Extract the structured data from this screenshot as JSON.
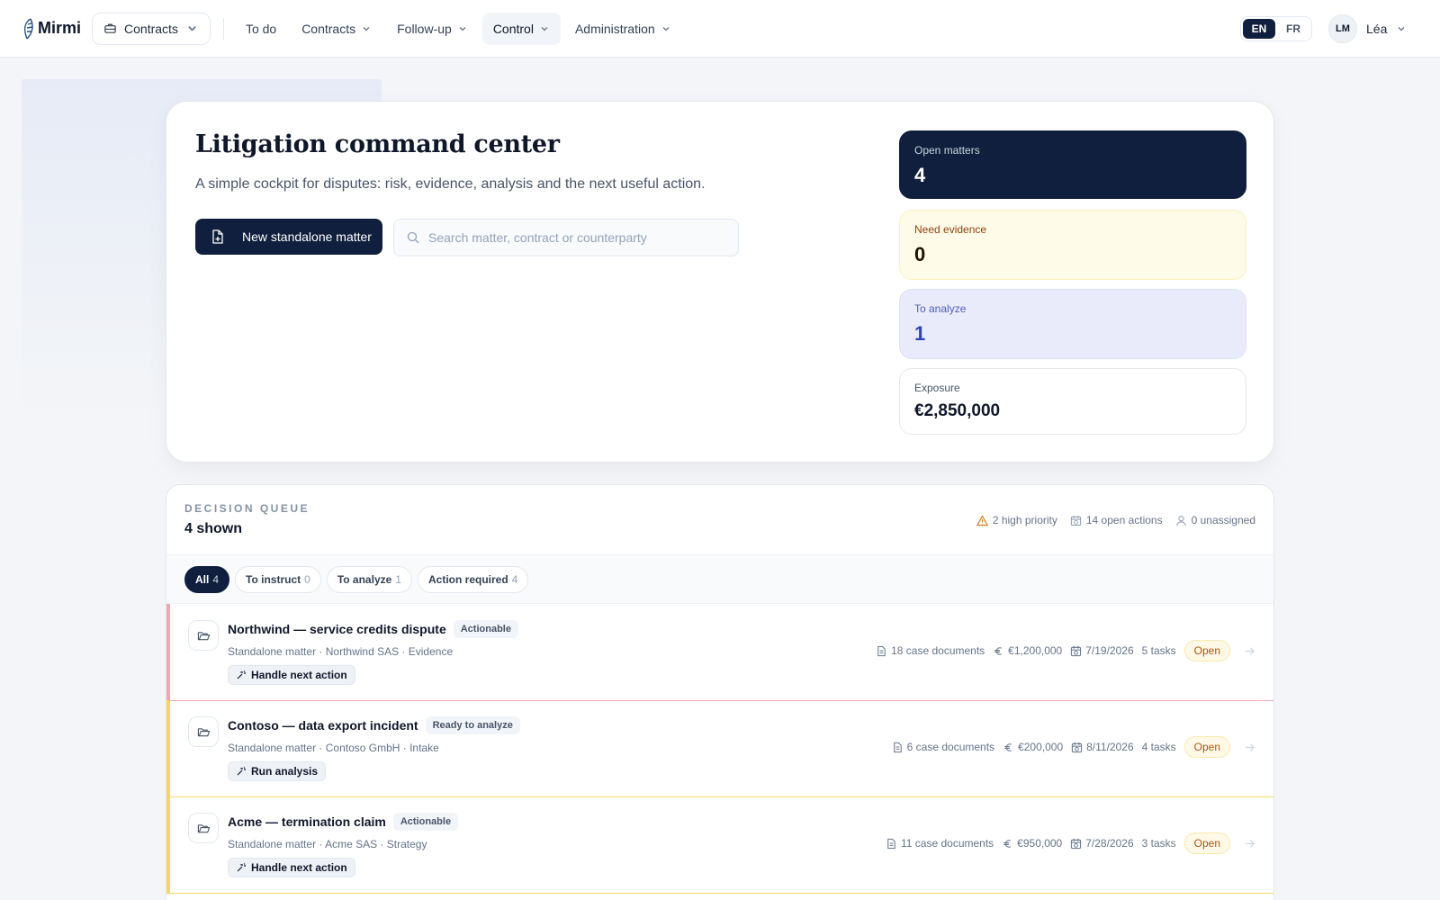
{
  "brand": {
    "name": "Mirmi"
  },
  "workspace": {
    "label": "Contracts"
  },
  "nav": {
    "todo": "To do",
    "contracts": "Contracts",
    "followup": "Follow-up",
    "control": "Control",
    "administration": "Administration"
  },
  "lang": {
    "en": "EN",
    "fr": "FR",
    "active": "EN"
  },
  "user": {
    "initials": "LM",
    "name": "Léa"
  },
  "hero": {
    "title": "Litigation command center",
    "subtitle": "A simple cockpit for disputes: risk, evidence, analysis and the next useful action.",
    "new_button": "New standalone matter",
    "search_placeholder": "Search matter, contract or counterparty"
  },
  "stats": {
    "open": {
      "label": "Open matters",
      "value": "4"
    },
    "evidence": {
      "label": "Need evidence",
      "value": "0"
    },
    "analyze": {
      "label": "To analyze",
      "value": "1"
    },
    "exposure": {
      "label": "Exposure",
      "value": "€2,850,000"
    }
  },
  "queue": {
    "kicker": "DECISION QUEUE",
    "count": "4 shown",
    "high_priority": "2 high priority",
    "open_actions": "14 open actions",
    "unassigned": "0 unassigned",
    "tabs": [
      {
        "label": "All",
        "count": "4"
      },
      {
        "label": "To instruct",
        "count": "0"
      },
      {
        "label": "To analyze",
        "count": "1"
      },
      {
        "label": "Action required",
        "count": "4"
      }
    ],
    "rows": [
      {
        "title": "Northwind — service credits dispute",
        "badge": "Actionable",
        "meta": "Standalone matter · Northwind SAS · Evidence",
        "action": "Handle next action",
        "docs": "18 case documents",
        "amount": "€1,200,000",
        "date": "7/19/2026",
        "tasks": "5 tasks",
        "status": "Open",
        "accent": "#f2a7b3"
      },
      {
        "title": "Contoso — data export incident",
        "badge": "Ready to analyze",
        "meta": "Standalone matter · Contoso GmbH · Intake",
        "action": "Run analysis",
        "docs": "6 case documents",
        "amount": "€200,000",
        "date": "8/11/2026",
        "tasks": "4 tasks",
        "status": "Open",
        "accent": "#f7d663"
      },
      {
        "title": "Acme — termination claim",
        "badge": "Actionable",
        "meta": "Standalone matter · Acme SAS · Strategy",
        "action": "Handle next action",
        "docs": "11 case documents",
        "amount": "€950,000",
        "date": "7/28/2026",
        "tasks": "3 tasks",
        "status": "Open",
        "accent": "#f7d663"
      }
    ]
  }
}
